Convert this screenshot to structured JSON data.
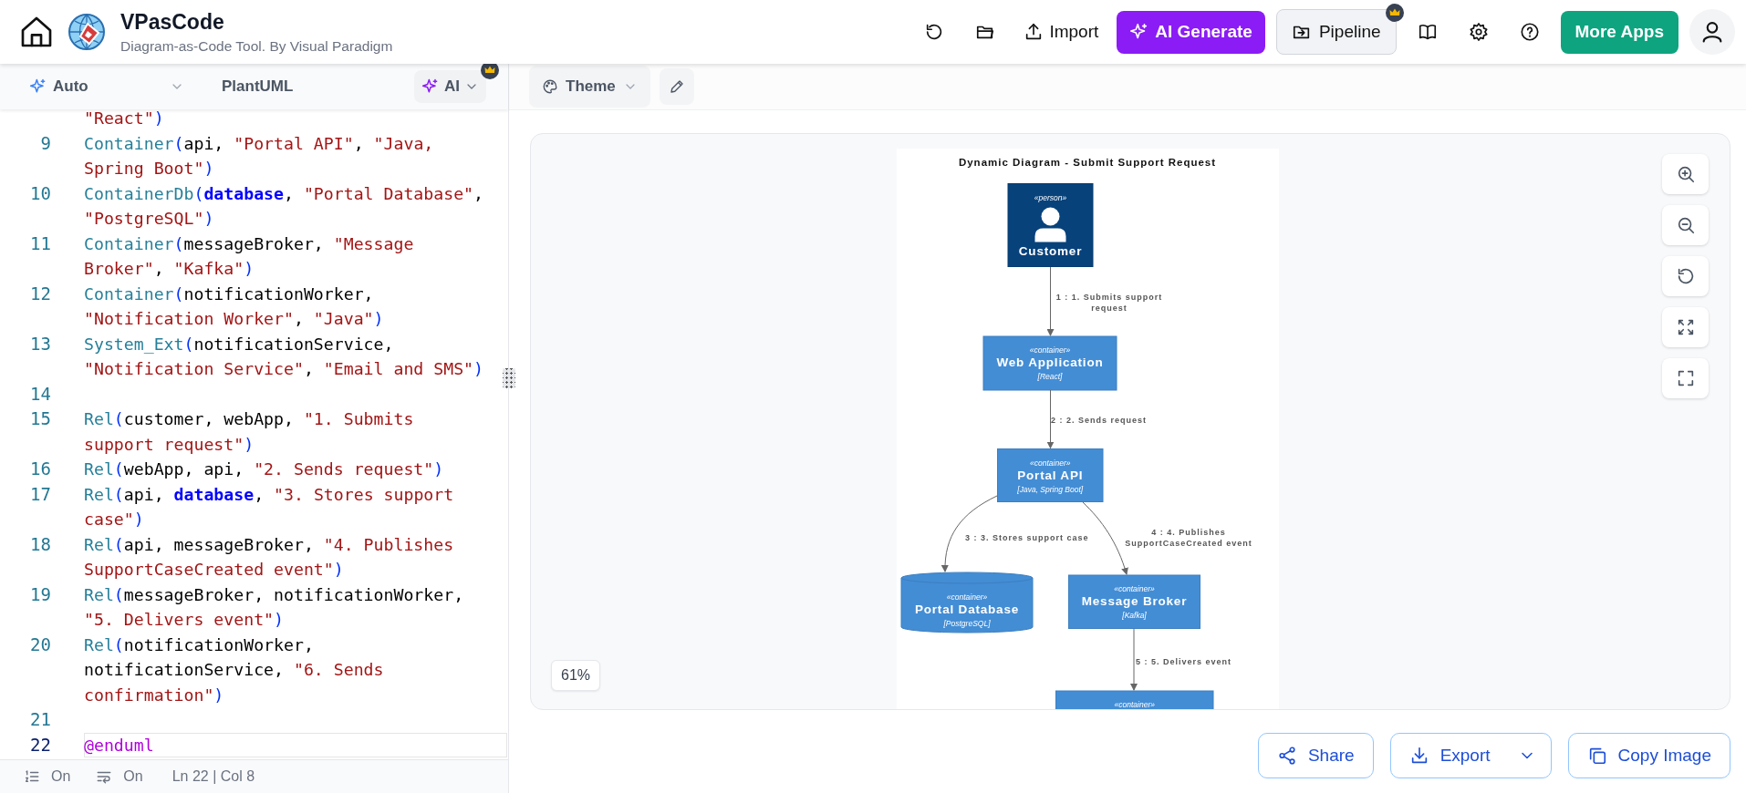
{
  "header": {
    "title": "VPasCode",
    "subtitle": "Diagram-as-Code Tool. By Visual Paradigm",
    "import_button": "Import",
    "ai_generate_button": "AI Generate",
    "pipeline_button": {
      "label": "Pipeline",
      "premium": true
    },
    "more_apps_button": "More Apps"
  },
  "editor": {
    "toolbar": {
      "mode_select": "Auto",
      "language": "PlantUML",
      "ai_select": {
        "label": "AI",
        "premium": true
      }
    },
    "lines": [
      {
        "current": false,
        "tokens": [
          {
            "kind": "str",
            "text": "\"React\""
          },
          {
            "kind": "paren",
            "text": ")"
          }
        ]
      },
      {
        "number": "9",
        "current": false,
        "tokens": [
          {
            "kind": "fn",
            "text": "Container"
          },
          {
            "kind": "paren",
            "text": "("
          },
          {
            "kind": "id",
            "text": "api, "
          },
          {
            "kind": "str",
            "text": "\"Portal API\""
          },
          {
            "kind": "id",
            "text": ", "
          },
          {
            "kind": "str",
            "text": "\"Java, Spring Boot\""
          },
          {
            "kind": "paren",
            "text": ")"
          }
        ]
      },
      {
        "number": "10",
        "current": false,
        "tokens": [
          {
            "kind": "fn",
            "text": "ContainerDb"
          },
          {
            "kind": "paren",
            "text": "("
          },
          {
            "kind": "kw",
            "text": "database"
          },
          {
            "kind": "id",
            "text": ", "
          },
          {
            "kind": "str",
            "text": "\"Portal Database\""
          },
          {
            "kind": "id",
            "text": ", "
          },
          {
            "kind": "str",
            "text": "\"PostgreSQL\""
          },
          {
            "kind": "paren",
            "text": ")"
          }
        ]
      },
      {
        "number": "11",
        "current": false,
        "tokens": [
          {
            "kind": "fn",
            "text": "Container"
          },
          {
            "kind": "paren",
            "text": "("
          },
          {
            "kind": "id",
            "text": "messageBroker, "
          },
          {
            "kind": "str",
            "text": "\"Message Broker\""
          },
          {
            "kind": "id",
            "text": ", "
          },
          {
            "kind": "str",
            "text": "\"Kafka\""
          },
          {
            "kind": "paren",
            "text": ")"
          }
        ]
      },
      {
        "number": "12",
        "current": false,
        "tokens": [
          {
            "kind": "fn",
            "text": "Container"
          },
          {
            "kind": "paren",
            "text": "("
          },
          {
            "kind": "id",
            "text": "notificationWorker, "
          },
          {
            "kind": "str",
            "text": "\"Notification Worker\""
          },
          {
            "kind": "id",
            "text": ", "
          },
          {
            "kind": "str",
            "text": "\"Java\""
          },
          {
            "kind": "paren",
            "text": ")"
          }
        ]
      },
      {
        "number": "13",
        "current": false,
        "tokens": [
          {
            "kind": "fn",
            "text": "System_Ext"
          },
          {
            "kind": "paren",
            "text": "("
          },
          {
            "kind": "id",
            "text": "notificationService, "
          },
          {
            "kind": "str",
            "text": "\"Notification Service\""
          },
          {
            "kind": "id",
            "text": ", "
          },
          {
            "kind": "str",
            "text": "\"Email and SMS\""
          },
          {
            "kind": "paren",
            "text": ")"
          }
        ]
      },
      {
        "number": "14",
        "current": false
      },
      {
        "number": "15",
        "current": false,
        "tokens": [
          {
            "kind": "fn",
            "text": "Rel"
          },
          {
            "kind": "paren",
            "text": "("
          },
          {
            "kind": "id",
            "text": "customer, webApp, "
          },
          {
            "kind": "str",
            "text": "\"1. Submits support request\""
          },
          {
            "kind": "paren",
            "text": ")"
          }
        ]
      },
      {
        "number": "16",
        "current": false,
        "tokens": [
          {
            "kind": "fn",
            "text": "Rel"
          },
          {
            "kind": "paren",
            "text": "("
          },
          {
            "kind": "id",
            "text": "webApp, api, "
          },
          {
            "kind": "str",
            "text": "\"2. Sends request\""
          },
          {
            "kind": "paren",
            "text": ")"
          }
        ]
      },
      {
        "number": "17",
        "current": false,
        "tokens": [
          {
            "kind": "fn",
            "text": "Rel"
          },
          {
            "kind": "paren",
            "text": "("
          },
          {
            "kind": "id",
            "text": "api, "
          },
          {
            "kind": "kw",
            "text": "database"
          },
          {
            "kind": "id",
            "text": ", "
          },
          {
            "kind": "str",
            "text": "\"3. Stores support case\""
          },
          {
            "kind": "paren",
            "text": ")"
          }
        ]
      },
      {
        "number": "18",
        "current": false,
        "tokens": [
          {
            "kind": "fn",
            "text": "Rel"
          },
          {
            "kind": "paren",
            "text": "("
          },
          {
            "kind": "id",
            "text": "api, messageBroker, "
          },
          {
            "kind": "str",
            "text": "\"4. Publishes SupportCaseCreated event\""
          },
          {
            "kind": "paren",
            "text": ")"
          }
        ]
      },
      {
        "number": "19",
        "current": false,
        "tokens": [
          {
            "kind": "fn",
            "text": "Rel"
          },
          {
            "kind": "paren",
            "text": "("
          },
          {
            "kind": "id",
            "text": "messageBroker, notificationWorker, "
          },
          {
            "kind": "str",
            "text": "\"5. Delivers event\""
          },
          {
            "kind": "paren",
            "text": ")"
          }
        ]
      },
      {
        "number": "20",
        "current": false,
        "tokens": [
          {
            "kind": "fn",
            "text": "Rel"
          },
          {
            "kind": "paren",
            "text": "("
          },
          {
            "kind": "id",
            "text": "notificationWorker, notificationService, "
          },
          {
            "kind": "str",
            "text": "\"6. Sends confirmation\""
          },
          {
            "kind": "paren",
            "text": ")"
          }
        ]
      },
      {
        "number": "21",
        "current": false
      },
      {
        "number": "22",
        "current": true,
        "tokens": [
          {
            "kind": "at",
            "text": "@enduml"
          }
        ]
      }
    ],
    "status_bar": {
      "line_numbers": "On",
      "word_wrap": "On",
      "cursor": "Ln 22 | Col 8"
    }
  },
  "preview": {
    "theme_select": "Theme",
    "zoom_level": "61%",
    "diagram": {
      "title": "Dynamic Diagram - Submit Support Request",
      "nodes": [
        {
          "kind": "person",
          "stereotype": "«person»",
          "name": "Customer"
        },
        {
          "kind": "container",
          "stereotype": "«container»",
          "name": "Web Application",
          "technology": "[React]"
        },
        {
          "kind": "container",
          "stereotype": "«container»",
          "name": "Portal API",
          "technology": "[Java, Spring Boot]"
        },
        {
          "kind": "database",
          "stereotype": "«container»",
          "name": "Portal Database",
          "technology": "[PostgreSQL]"
        },
        {
          "kind": "container",
          "stereotype": "«container»",
          "name": "Message Broker",
          "technology": "[Kafka]"
        },
        {
          "kind": "container",
          "stereotype": "«container»"
        }
      ],
      "edges": [
        {
          "label": [
            "1 : 1. Submits support",
            "request"
          ]
        },
        {
          "label": [
            "2 : 2. Sends request"
          ]
        },
        {
          "label": [
            "3 : 3. Stores support case"
          ]
        },
        {
          "label": [
            "4 : 4. Publishes",
            "SupportCaseCreated event"
          ]
        },
        {
          "label": [
            "5 : 5. Delivers event"
          ]
        }
      ]
    },
    "buttons": {
      "share": "Share",
      "export": "Export",
      "copy_image": "Copy Image"
    }
  }
}
